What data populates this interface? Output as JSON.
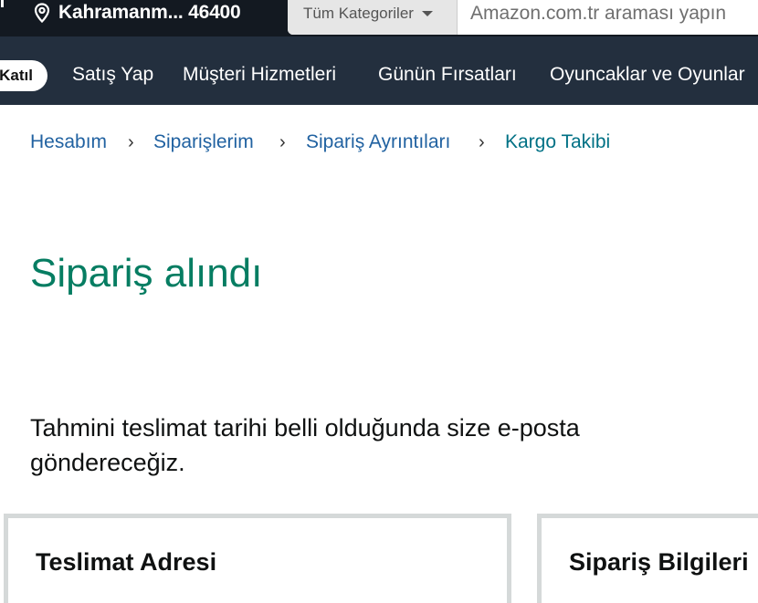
{
  "header": {
    "location_text": "Kahramanm... 46400",
    "search": {
      "category_label": "Tüm Kategoriler",
      "placeholder": "Amazon.com.tr araması yapın"
    }
  },
  "nav": {
    "join_label": "Katıl",
    "items": [
      {
        "label": "Satış Yap"
      },
      {
        "label": "Müşteri Hizmetleri"
      },
      {
        "label": "Günün Fırsatları"
      },
      {
        "label": "Oyuncaklar ve Oyunlar"
      }
    ]
  },
  "breadcrumb": {
    "items": [
      {
        "label": "Hesabım"
      },
      {
        "label": "Siparişlerim"
      },
      {
        "label": "Sipariş Ayrıntıları"
      },
      {
        "label": "Kargo Takibi"
      }
    ],
    "separator": "›"
  },
  "main": {
    "title": "Sipariş alındı",
    "notice": "Tahmini teslimat tarihi belli olduğunda size e-posta göndereceğiz.",
    "cards": [
      {
        "title": "Teslimat Adresi"
      },
      {
        "title": "Sipariş Bilgileri"
      }
    ]
  },
  "colors": {
    "header_bg": "#131921",
    "nav_bg": "#232f3e",
    "link": "#2162a1",
    "title_green": "#067d62"
  }
}
